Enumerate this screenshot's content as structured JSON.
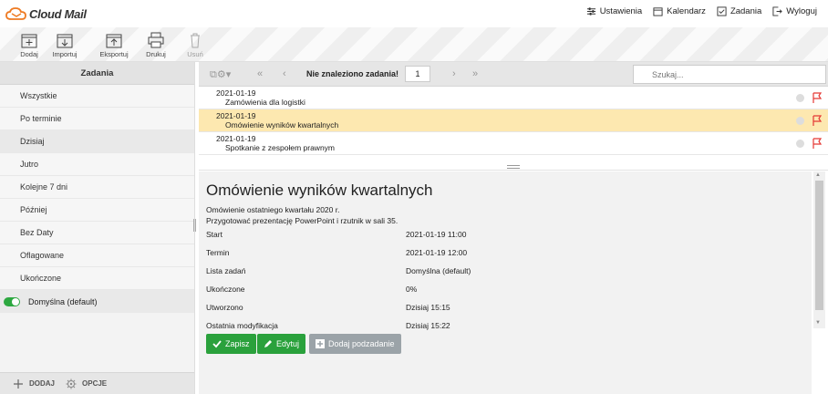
{
  "app": {
    "name": "Cloud Mail"
  },
  "topnav": [
    {
      "label": "Ustawienia",
      "icon": "settings-sliders-icon"
    },
    {
      "label": "Kalendarz",
      "icon": "calendar-icon"
    },
    {
      "label": "Zadania",
      "icon": "tasks-icon"
    },
    {
      "label": "Wyloguj",
      "icon": "logout-icon"
    }
  ],
  "toolbar": {
    "add": "Dodaj",
    "import": "Importuj",
    "export": "Eksportuj",
    "print": "Drukuj",
    "delete": "Usuń"
  },
  "sidebar": {
    "title": "Zadania",
    "items": [
      "Wszystkie",
      "Po terminie",
      "Dzisiaj",
      "Jutro",
      "Kolejne 7 dni",
      "Później",
      "Bez Daty",
      "Oflagowane",
      "Ukończone"
    ],
    "active_index": 2,
    "list": {
      "label": "Domyślna (default)",
      "enabled": true
    },
    "footer": {
      "add": "DODAJ",
      "options": "OPCJE"
    }
  },
  "listhead": {
    "message": "Nie znaleziono zadania!",
    "page": "1",
    "search_placeholder": "Szukaj..."
  },
  "tasks": [
    {
      "date": "2021-01-19",
      "title": "Zamówienia dla logistki",
      "selected": false
    },
    {
      "date": "2021-01-19",
      "title": "Omówienie wyników kwartalnych",
      "selected": true
    },
    {
      "date": "2021-01-19",
      "title": "Spotkanie z zespołem prawnym",
      "selected": false
    }
  ],
  "details": {
    "title": "Omówienie wyników kwartalnych",
    "desc1": "Omówienie ostatniego kwartału 2020 r.",
    "desc2": "Przygotować prezentację PowerPoint i rzutnik w sali 35.",
    "fields": [
      {
        "label": "Start",
        "value": "2021-01-19 11:00"
      },
      {
        "label": "Termin",
        "value": "2021-01-19 12:00"
      },
      {
        "label": "Lista zadań",
        "value": "Domyślna (default)"
      },
      {
        "label": "Ukończone",
        "value": "0%"
      },
      {
        "label": "Utworzono",
        "value": "Dzisiaj 15:15"
      },
      {
        "label": "Ostatnia modyfikacja",
        "value": "Dzisiaj 15:22"
      }
    ],
    "buttons": {
      "save": "Zapisz",
      "edit": "Edytuj",
      "subtask": "Dodaj podzadanie"
    }
  },
  "colors": {
    "accent": "#ee7a22",
    "green": "#2aa13c",
    "selected_row": "#fde8b0",
    "flag": "#e53935"
  }
}
